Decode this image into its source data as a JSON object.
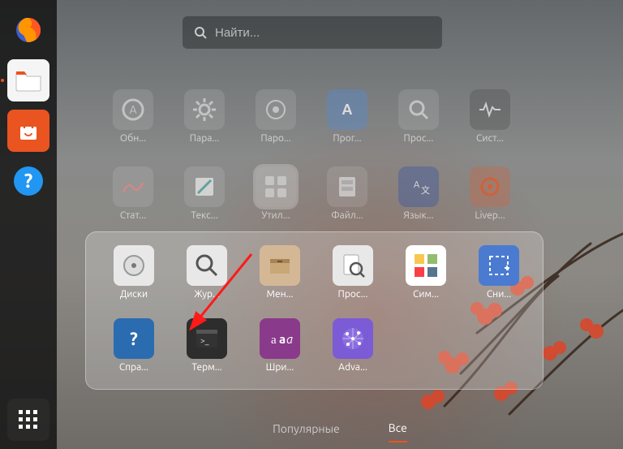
{
  "search": {
    "placeholder": "Найти..."
  },
  "dock": {
    "items": [
      {
        "name": "firefox",
        "active": false
      },
      {
        "name": "files",
        "active": true
      },
      {
        "name": "software",
        "active": false
      },
      {
        "name": "help",
        "active": false
      }
    ]
  },
  "background_apps": {
    "row1": [
      {
        "label": "Обн...",
        "name": "software-updater"
      },
      {
        "label": "Пара...",
        "name": "settings"
      },
      {
        "label": "Паро...",
        "name": "passwords"
      },
      {
        "label": "Прог...",
        "name": "software-center"
      },
      {
        "label": "Прос...",
        "name": "document-viewer"
      },
      {
        "label": "Сист...",
        "name": "system-monitor"
      }
    ],
    "row2": [
      {
        "label": "Стат...",
        "name": "power-stats"
      },
      {
        "label": "Текс...",
        "name": "text-editor"
      },
      {
        "label": "Утил...",
        "name": "utilities",
        "selected": true
      },
      {
        "label": "Файл...",
        "name": "files-app"
      },
      {
        "label": "Язык...",
        "name": "language"
      },
      {
        "label": "Livep...",
        "name": "livepatch"
      }
    ]
  },
  "folder": {
    "name": "utilities",
    "apps": [
      {
        "label": "Диски",
        "name": "disks"
      },
      {
        "label": "Жур...",
        "name": "logs"
      },
      {
        "label": "Мен...",
        "name": "archive-manager"
      },
      {
        "label": "Прос...",
        "name": "font-viewer"
      },
      {
        "label": "Сим...",
        "name": "characters"
      },
      {
        "label": "Сни...",
        "name": "screenshot"
      },
      {
        "label": "Спра...",
        "name": "help"
      },
      {
        "label": "Терм...",
        "name": "terminal"
      },
      {
        "label": "Шри...",
        "name": "fonts"
      },
      {
        "label": "Adva...",
        "name": "advanced-network"
      }
    ]
  },
  "tabs": {
    "popular": "Популярные",
    "all": "Все",
    "active": "all"
  },
  "annotation": {
    "arrow_target": "terminal"
  },
  "colors": {
    "accent": "#e95420"
  }
}
